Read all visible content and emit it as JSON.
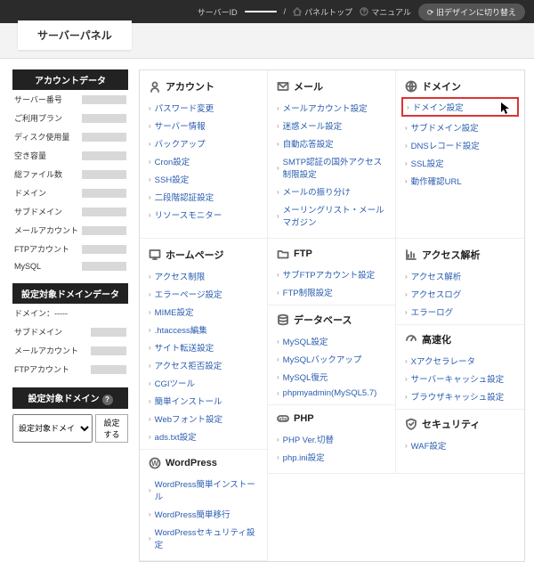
{
  "topbar": {
    "server_id_label": "サーバーID",
    "server_id_value": "",
    "panel_top": "パネルトップ",
    "manual": "マニュアル",
    "switch_design": "旧デザインに切り替え"
  },
  "header": {
    "title": "サーバーパネル"
  },
  "side": {
    "account_data_h": "アカウントデータ",
    "rows": [
      {
        "label": "サーバー番号"
      },
      {
        "label": "ご利用プラン"
      },
      {
        "label": "ディスク使用量"
      },
      {
        "label": "空き容量"
      },
      {
        "label": "総ファイル数"
      },
      {
        "label": "ドメイン"
      },
      {
        "label": "サブドメイン"
      },
      {
        "label": "メールアカウント"
      },
      {
        "label": "FTPアカウント"
      },
      {
        "label": "MySQL"
      }
    ],
    "target_domain_data_h": "設定対象ドメインデータ",
    "target_rows": [
      {
        "label": "ドメイン：-----"
      },
      {
        "label": "サブドメイン"
      },
      {
        "label": "メールアカウント"
      },
      {
        "label": "FTPアカウント"
      }
    ],
    "target_domain_h": "設定対象ドメイン",
    "select_label": "設定対象ドメイ",
    "set_btn": "設定する"
  },
  "sections": {
    "account": {
      "title": "アカウント",
      "items": [
        "パスワード変更",
        "サーバー情報",
        "バックアップ",
        "Cron設定",
        "SSH設定",
        "二段階認証設定",
        "リソースモニター"
      ]
    },
    "mail": {
      "title": "メール",
      "items": [
        "メールアカウント設定",
        "迷惑メール設定",
        "自動応答設定",
        "SMTP認証の国外アクセス制限設定",
        "メールの振り分け",
        "メーリングリスト・メールマガジン"
      ]
    },
    "domain": {
      "title": "ドメイン",
      "items": [
        "ドメイン設定",
        "サブドメイン設定",
        "DNSレコード設定",
        "SSL設定",
        "動作確認URL"
      ]
    },
    "homepage": {
      "title": "ホームページ",
      "items": [
        "アクセス制限",
        "エラーページ設定",
        "MIME設定",
        ".htaccess編集",
        "サイト転送設定",
        "アクセス拒否設定",
        "CGIツール",
        "簡単インストール",
        "Webフォント設定",
        "ads.txt設定"
      ]
    },
    "ftp": {
      "title": "FTP",
      "items": [
        "サブFTPアカウント設定",
        "FTP制限設定"
      ]
    },
    "access": {
      "title": "アクセス解析",
      "items": [
        "アクセス解析",
        "アクセスログ",
        "エラーログ"
      ]
    },
    "database": {
      "title": "データベース",
      "items": [
        "MySQL設定",
        "MySQLバックアップ",
        "MySQL復元",
        "phpmyadmin(MySQL5.7)"
      ]
    },
    "speed": {
      "title": "高速化",
      "items": [
        "Xアクセラレータ",
        "サーバーキャッシュ設定",
        "ブラウザキャッシュ設定"
      ]
    },
    "wordpress": {
      "title": "WordPress",
      "items": [
        "WordPress簡単インストール",
        "WordPress簡単移行",
        "WordPressセキュリティ設定"
      ]
    },
    "php": {
      "title": "PHP",
      "items": [
        "PHP Ver.切替",
        "php.ini設定"
      ]
    },
    "security": {
      "title": "セキュリティ",
      "items": [
        "WAF設定"
      ]
    }
  }
}
